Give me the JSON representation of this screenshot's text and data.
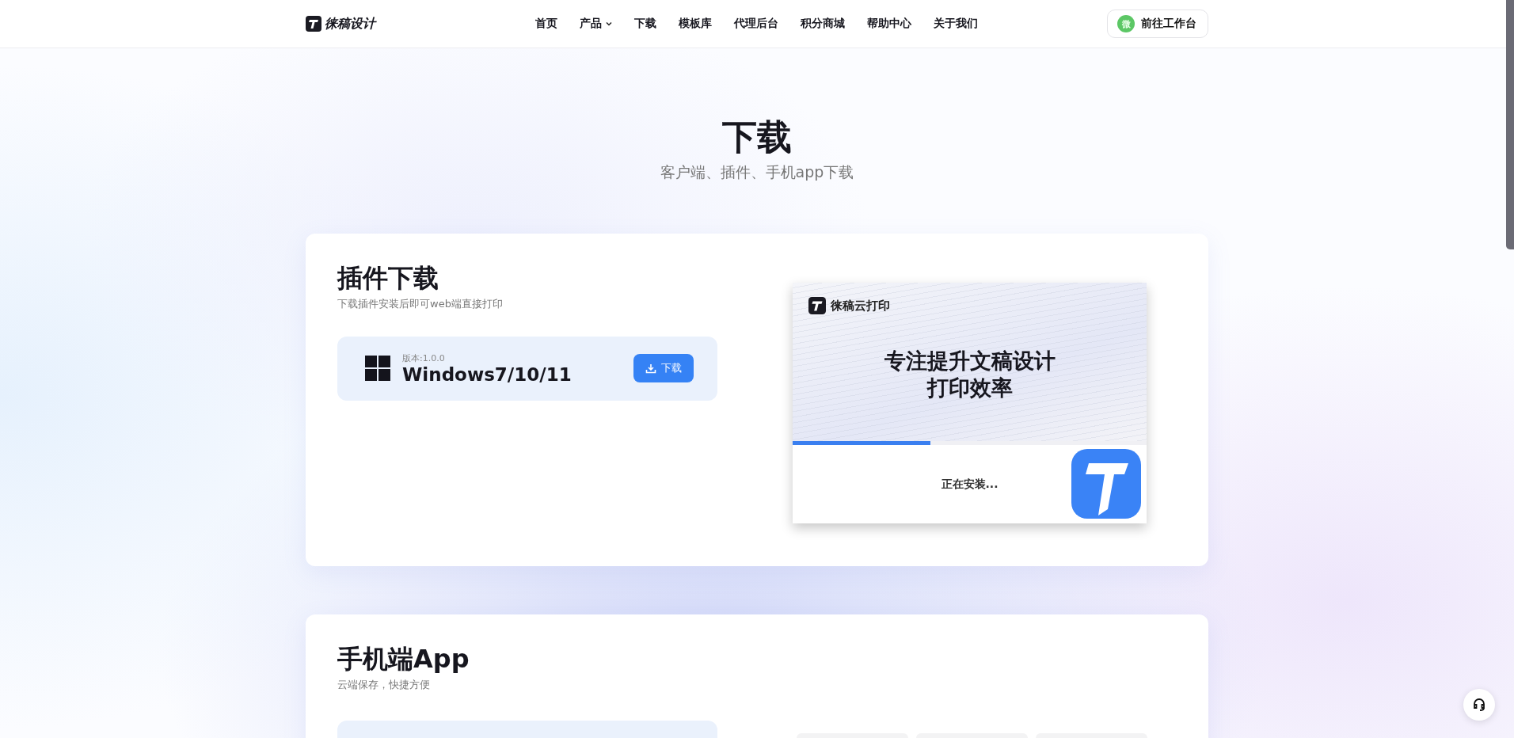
{
  "header": {
    "logo": "徕稿设计",
    "nav": [
      {
        "label": "首页",
        "dropdown": false
      },
      {
        "label": "产品",
        "dropdown": true
      },
      {
        "label": "下载",
        "dropdown": false
      },
      {
        "label": "模板库",
        "dropdown": false
      },
      {
        "label": "代理后台",
        "dropdown": false
      },
      {
        "label": "积分商城",
        "dropdown": false
      },
      {
        "label": "帮助中心",
        "dropdown": false
      },
      {
        "label": "关于我们",
        "dropdown": false
      }
    ],
    "workspace_button": {
      "badge": "微",
      "label": "前往工作台"
    }
  },
  "hero": {
    "title": "下载",
    "subtitle": "客户端、插件、手机app下载"
  },
  "plugin_section": {
    "title": "插件下载",
    "subtitle": "下载插件安装后即可web端直接打印",
    "download": {
      "version": "版本:1.0.0",
      "platform": "Windows7/10/11",
      "button": "下载"
    },
    "installer": {
      "brand": "徕稿云打印",
      "headline": [
        "专注提升文稿设计",
        "打印效率"
      ],
      "progress": {
        "level": 0.39
      },
      "status": "正在安装..."
    }
  },
  "mobile_section": {
    "title": "手机端App",
    "subtitle": "云端保存，快捷方便"
  }
}
